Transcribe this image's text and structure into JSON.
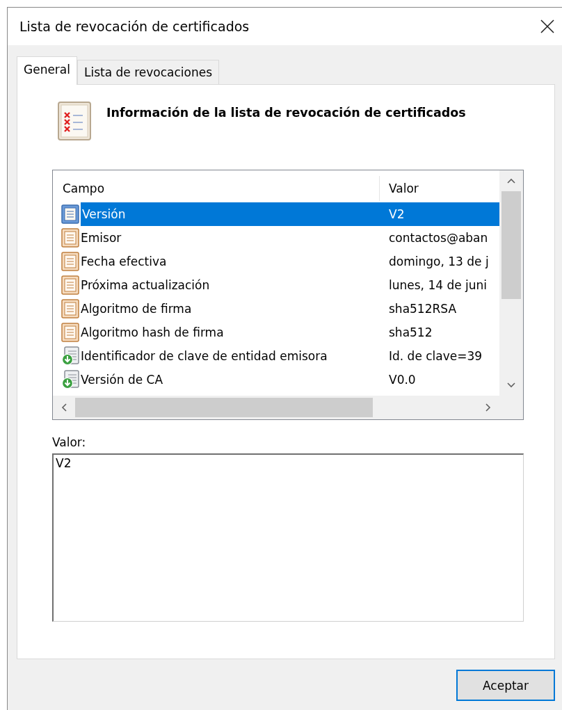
{
  "window": {
    "title": "Lista de revocación de certificados"
  },
  "tabs": [
    {
      "label": "General",
      "selected": true
    },
    {
      "label": "Lista de revocaciones",
      "selected": false
    }
  ],
  "heading": "Información de la lista de revocación de certificados",
  "table": {
    "columns": [
      "Campo",
      "Valor"
    ],
    "rows": [
      {
        "kind": "field",
        "field": "Versión",
        "value": "V2",
        "selected": true
      },
      {
        "kind": "field",
        "field": "Emisor",
        "value": "contactos@aban",
        "selected": false
      },
      {
        "kind": "field",
        "field": "Fecha efectiva",
        "value": "domingo, 13 de j",
        "selected": false
      },
      {
        "kind": "field",
        "field": "Próxima actualización",
        "value": "lunes, 14 de juni",
        "selected": false
      },
      {
        "kind": "field",
        "field": "Algoritmo de firma",
        "value": "sha512RSA",
        "selected": false
      },
      {
        "kind": "field",
        "field": "Algoritmo hash de firma",
        "value": "sha512",
        "selected": false
      },
      {
        "kind": "extension",
        "field": "Identificador de clave de entidad emisora",
        "value": "Id. de clave=39",
        "selected": false
      },
      {
        "kind": "extension",
        "field": "Versión de CA",
        "value": "V0.0",
        "selected": false
      }
    ]
  },
  "value_label": "Valor:",
  "value_box": {
    "value": "V2"
  },
  "buttons": [
    {
      "label": "Aceptar"
    }
  ]
}
